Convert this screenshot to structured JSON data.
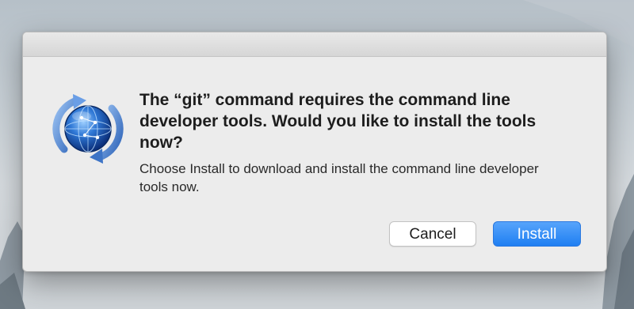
{
  "dialog": {
    "heading": "The “git” command requires the command line developer tools. Would you like to install the tools now?",
    "message": "Choose Install to download and install the command line developer tools now.",
    "icon": "software-update-icon",
    "buttons": {
      "cancel_label": "Cancel",
      "install_label": "Install"
    }
  },
  "colors": {
    "accent": "#1f7ff2",
    "dialog_background": "#ececec"
  }
}
